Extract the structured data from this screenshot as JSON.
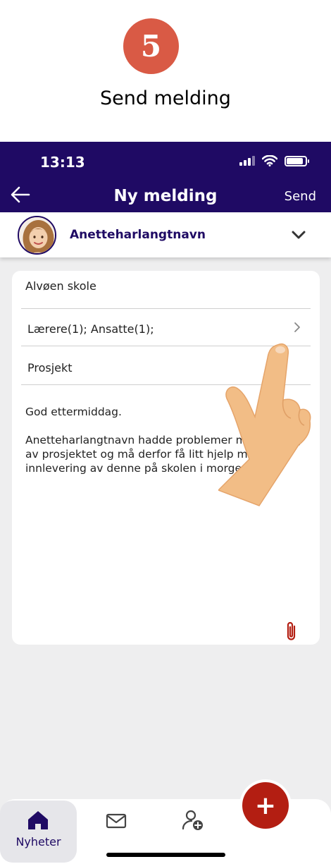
{
  "step": {
    "number": "5",
    "title": "Send melding"
  },
  "status_bar": {
    "time": "13:13",
    "battery_level_percent": 90
  },
  "nav": {
    "title": "Ny melding",
    "send_label": "Send",
    "back_icon": "arrow-left-icon"
  },
  "recipient": {
    "name": "Anetteharlangtnavn"
  },
  "form": {
    "school": "Alvøen skole",
    "recipients": "Lærere(1); Ansatte(1);",
    "subject": "Prosjekt",
    "body": "God ettermiddag.\n\nAnetteharlangtnavn hadde problemer med lagring av prosjektet og må derfor få litt hjelp med innlevering av denne på skolen i morgen."
  },
  "bottom_nav": {
    "home_label": "Nyheter",
    "fab_label": "+"
  },
  "colors": {
    "primary": "#1f0a64",
    "step_badge": "#d95a45",
    "fab": "#b31e12",
    "attach": "#b31e12"
  }
}
